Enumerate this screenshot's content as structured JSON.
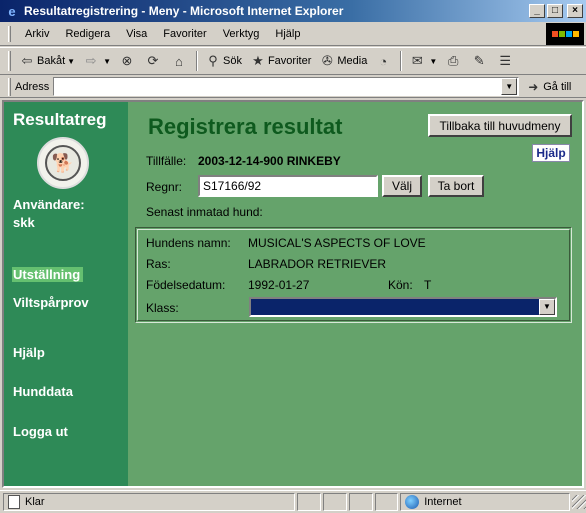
{
  "window": {
    "title": "Resultatregistrering - Meny - Microsoft Internet Explorer",
    "buttons": [
      "_",
      "□",
      "×"
    ]
  },
  "menubar": {
    "items": [
      {
        "label": "Arkiv"
      },
      {
        "label": "Redigera"
      },
      {
        "label": "Visa"
      },
      {
        "label": "Favoriter"
      },
      {
        "label": "Verktyg"
      },
      {
        "label": "Hjälp"
      }
    ]
  },
  "toolbar": {
    "back": "Bakåt",
    "search": "Sök",
    "favorites": "Favoriter",
    "media": "Media",
    "icons": [
      "back-arrow-icon",
      "forward-arrow-icon",
      "stop-icon",
      "refresh-icon",
      "home-icon",
      "search-icon",
      "favorites-icon",
      "media-icon",
      "history-icon",
      "mail-icon",
      "print-icon",
      "edit-icon",
      "discuss-icon"
    ]
  },
  "addressbar": {
    "label": "Adress",
    "value": "",
    "go": "Gå till"
  },
  "sidebar": {
    "title": "Resultatreg",
    "user_label": "Användare:",
    "user_name": "skk",
    "nav": [
      {
        "label": "Utställning",
        "active": true
      },
      {
        "label": "Viltspårprov",
        "active": false
      },
      {
        "label": "Hjälp",
        "active": false
      },
      {
        "label": "Hunddata",
        "active": false
      },
      {
        "label": "Logga ut",
        "active": false
      }
    ]
  },
  "main": {
    "title": "Registrera resultat",
    "back_button": "Tillbaka till huvudmeny",
    "help_link": "Hjälp",
    "occasion_label": "Tillfälle:",
    "occasion_value": "2003-12-14-900 RINKEBY",
    "regnr_label": "Regnr:",
    "regnr_value": "S17166/92",
    "choose_button": "Välj",
    "delete_button": "Ta bort",
    "last_entered_label": "Senast inmatad hund:",
    "dog": {
      "name_label": "Hundens namn:",
      "name_value": "MUSICAL'S ASPECTS OF LOVE",
      "breed_label": "Ras:",
      "breed_value": "LABRADOR RETRIEVER",
      "birth_label": "Födelsedatum:",
      "birth_value": "1992-01-27",
      "sex_label": "Kön:",
      "sex_value": "T",
      "class_label": "Klass:",
      "class_value": ""
    }
  },
  "statusbar": {
    "text": "Klar",
    "zone": "Internet"
  },
  "colors": {
    "sidebar_bg": "#2e8a57",
    "content_bg": "#65a36b",
    "title_green": "#0e5a1e",
    "active_nav": "#65c070",
    "select_bg": "#0a246a"
  }
}
